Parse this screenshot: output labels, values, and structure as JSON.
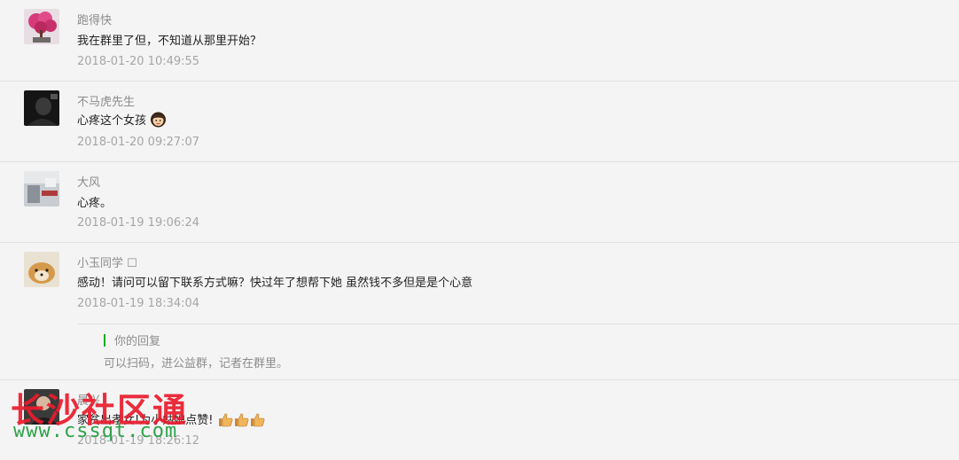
{
  "comments": [
    {
      "name": "跑得快",
      "text": "我在群里了但，不知道从那里开始？",
      "time": "2018-01-20 10:49:55"
    },
    {
      "name": "不马虎先生",
      "text": "心疼这个女孩",
      "time": "2018-01-20 09:27:07"
    },
    {
      "name": "大风",
      "text": "心疼。",
      "time": "2018-01-19 19:06:24"
    },
    {
      "name": "小玉同学 ☐",
      "text": "感动！请问可以留下联系方式嘛？快过年了想帮下她 虽然钱不多但是是个心意",
      "time": "2018-01-19 18:34:04"
    },
    {
      "name": "晨兴",
      "text": "家贫出孝女!为小姑娘点赞!",
      "time": "2018-01-19 18:26:12"
    }
  ],
  "reply": {
    "label": "你的回复",
    "text": "可以扫码，进公益群，记者在群里。"
  },
  "watermark": {
    "title": "长沙社区通",
    "url": "www.cssqt.com"
  },
  "colors": {
    "accent": "#1aad19",
    "watermark_red": "#ea1c2c",
    "watermark_green": "#2fa34a"
  }
}
